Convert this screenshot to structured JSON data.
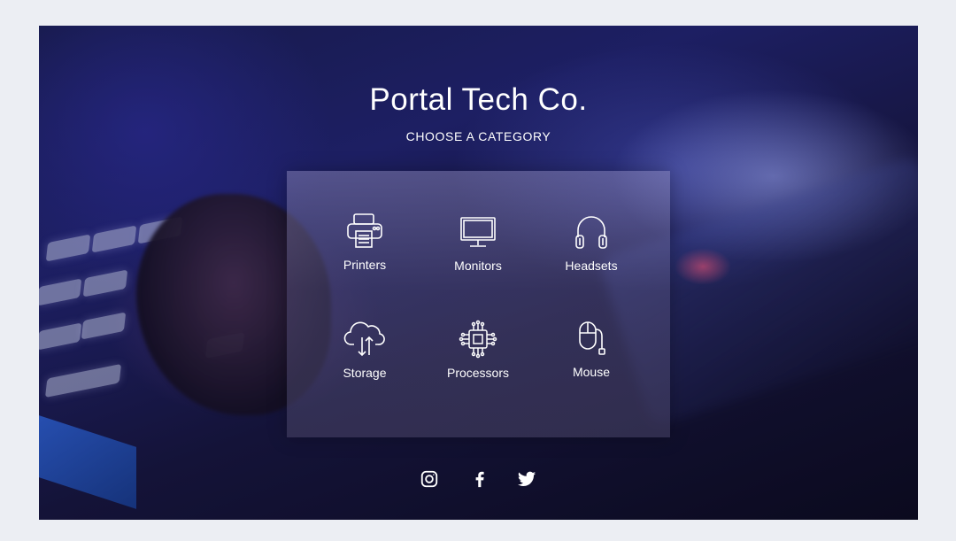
{
  "header": {
    "title": "Portal Tech Co.",
    "subtitle": "CHOOSE A CATEGORY"
  },
  "categories": [
    {
      "label": "Printers",
      "icon": "printer-icon"
    },
    {
      "label": "Monitors",
      "icon": "monitor-icon"
    },
    {
      "label": "Headsets",
      "icon": "headset-icon"
    },
    {
      "label": "Storage",
      "icon": "cloud-storage-icon"
    },
    {
      "label": "Processors",
      "icon": "processor-icon"
    },
    {
      "label": "Mouse",
      "icon": "mouse-icon"
    }
  ],
  "social": [
    {
      "name": "instagram-icon"
    },
    {
      "name": "facebook-icon"
    },
    {
      "name": "twitter-icon"
    }
  ],
  "colors": {
    "text": "#ffffff",
    "page_background": "#eceef3",
    "accent_red": "#f0465a"
  }
}
